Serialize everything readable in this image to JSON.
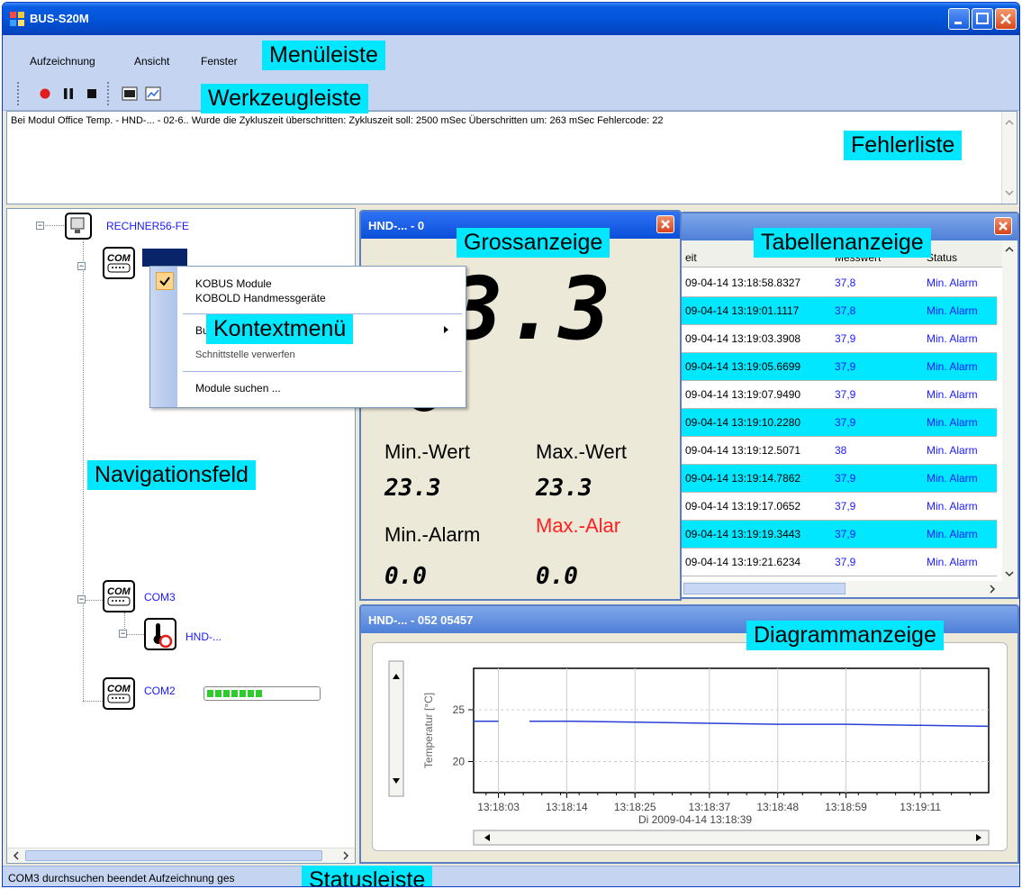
{
  "window": {
    "title": "BUS-S20M"
  },
  "menu": {
    "items": [
      "Aufzeichnung",
      "Ansicht",
      "Fenster"
    ]
  },
  "errorlist": {
    "text": "Bei Modul Office Temp. - HND-... - 02-6.. Wurde die Zykluszeit überschritten: Zykluszeit soll: 2500 mSec Überschritten um: 263 mSec Fehlercode: 22"
  },
  "tree": {
    "root": "RECHNER56-FE",
    "com3": "COM3",
    "hnd": "HND-...",
    "com2": "COM2",
    "com_badge": "COM",
    "com2_progress": 0.5
  },
  "context_menu": {
    "item1": "KOBUS Module",
    "item2": "KOBOLD Handmessgeräte",
    "item3_partial": "Bu",
    "item4_partial": "Schnittstelle verwerfen",
    "item5": "Module suchen ..."
  },
  "big_display": {
    "title": "HND-... - 0",
    "value": "3.3",
    "min_label": "Min.-Wert",
    "max_label": "Max.-Wert",
    "min_value": "23.3",
    "max_value": "23.3",
    "min_alarm_label": "Min.-Alarm",
    "max_alarm_label": "Max.-Alar",
    "min_alarm_value": "0.0",
    "max_alarm_value": "0.0"
  },
  "table": {
    "headers": [
      "eit",
      "Messwert",
      "Status"
    ],
    "rows": [
      [
        "09-04-14 13:18:58.8327",
        "37,8",
        "Min. Alarm"
      ],
      [
        "09-04-14 13:19:01.1117",
        "37,8",
        "Min. Alarm"
      ],
      [
        "09-04-14 13:19:03.3908",
        "37,9",
        "Min. Alarm"
      ],
      [
        "09-04-14 13:19:05.6699",
        "37,9",
        "Min. Alarm"
      ],
      [
        "09-04-14 13:19:07.9490",
        "37,9",
        "Min. Alarm"
      ],
      [
        "09-04-14 13:19:10.2280",
        "37,9",
        "Min. Alarm"
      ],
      [
        "09-04-14 13:19:12.5071",
        "38",
        "Min. Alarm"
      ],
      [
        "09-04-14 13:19:14.7862",
        "37,9",
        "Min. Alarm"
      ],
      [
        "09-04-14 13:19:17.0652",
        "37,9",
        "Min. Alarm"
      ],
      [
        "09-04-14 13:19:19.3443",
        "37,9",
        "Min. Alarm"
      ],
      [
        "09-04-14 13:19:21.6234",
        "37,9",
        "Min. Alarm"
      ]
    ]
  },
  "diagram": {
    "title": "HND-... - 052 05457",
    "ylabel": "Temperatur [°C]",
    "xticks": [
      "13:18:03",
      "13:18:14",
      "13:18:25",
      "13:18:37",
      "13:18:48",
      "13:18:59",
      "13:19:11"
    ],
    "xlabel": "Di 2009-04-14 13:18:39"
  },
  "chart_data": {
    "type": "line",
    "title": "",
    "xlabel": "Di 2009-04-14 13:18:39",
    "ylabel": "Temperatur [°C]",
    "ylim": [
      17,
      29
    ],
    "yticks": [
      20,
      25
    ],
    "xlim": [
      "13:17:59",
      "13:19:22"
    ],
    "x": [
      "13:17:59",
      "13:18:03",
      "13:18:08",
      "13:18:14",
      "13:18:25",
      "13:18:37",
      "13:18:48",
      "13:18:59",
      "13:19:11",
      "13:19:22"
    ],
    "series": [
      {
        "values": [
          23.9,
          23.9,
          23.9,
          23.9,
          23.8,
          23.7,
          23.6,
          23.6,
          23.5,
          23.4
        ]
      }
    ],
    "gap_between": [
      "13:18:03",
      "13:18:08"
    ],
    "grid": true,
    "line_color": "#2a3fd6"
  },
  "statusbar": {
    "text": "COM3 durchsuchen beendet  Aufzeichnung ges"
  },
  "callouts": {
    "menuleiste": "Menüleiste",
    "werkzeugleiste": "Werkzeugleiste",
    "fehlerliste": "Fehlerliste",
    "grossanzeige": "Grossanzeige",
    "tabellenanzeige": "Tabellenanzeige",
    "kontextmenu": "Kontextmenü",
    "navigationsfeld": "Navigationsfeld",
    "diagrammanzeige": "Diagrammanzeige",
    "statusleiste": "Statusleiste"
  },
  "colors": {
    "callout_bg": "#00e7ff",
    "row_highlight": "#00e7ff",
    "link_blue": "#1a1aff",
    "alarm_red": "#ff2020"
  }
}
